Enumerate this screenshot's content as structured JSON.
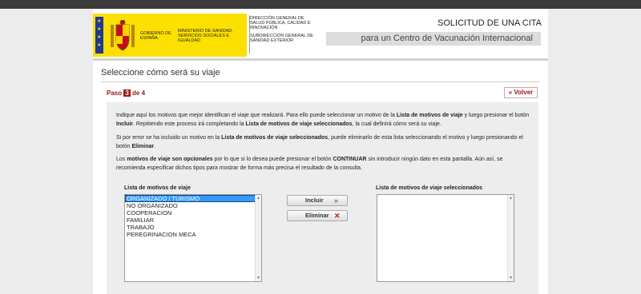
{
  "header": {
    "gobierno": "GOBIERNO DE ESPAÑA",
    "ministerio": "MINISTERIO DE SANIDAD, SERVICIOS SOCIALES E IGUALDAD",
    "direccion": "DIRECCIÓN GENERAL DE SALUD PÚBLICA, CALIDAD E INNOVACIÓN",
    "subdireccion": "SUBDIRECCIÓN GENERAL DE SANIDAD EXTERIOR",
    "title": "SOLICITUD DE UNA CITA",
    "subtitle": "para un Centro de Vacunación Internacional"
  },
  "page": {
    "title": "Seleccione cómo será su viaje",
    "paso_label": "Paso",
    "paso_num": "3",
    "paso_total": "de 4",
    "volver": "Volver"
  },
  "instructions": {
    "p1": "Indique aquí los motivos que mejor identifican el viaje que realizará. Para ello puede seleccionar un motivo de la Lista de motivos de viaje y luego presionar el botón Incluir. Repitiendo este proceso irá completando la Lista de motivos de viaje seleccionados, la cual definirá cómo será su viaje.",
    "p2": "Si por error se ha incluido un motivo en la Lista de motivos de viaje seleccionados, puede eliminarlo de esta lista seleccionando el motivo y luego presionando el botón Eliminar.",
    "p3": "Los motivos de viaje son opcionales por lo que si lo desea puede presionar el botón CONTINUAR sin introducir ningún dato en esta pantalla. Aún así, se recomienda especificar dichos tipos para mostrar de forma más precisa el resultado de la consulta."
  },
  "lists": {
    "left_label": "Lista de motivos de viaje",
    "right_label": "Lista de motivos de viaje seleccionados",
    "options": [
      "ORGANIZADO / TURISMO",
      "NO ORGANIZADO",
      "COOPERACION",
      "FAMILIAR",
      "TRABAJO",
      "PEREGRINACION MECA"
    ],
    "selected_index": 0
  },
  "buttons": {
    "incluir": "Incluir",
    "eliminar": "Eliminar"
  },
  "colors": {
    "accent": "#a01818",
    "selection": "#3399ff"
  }
}
